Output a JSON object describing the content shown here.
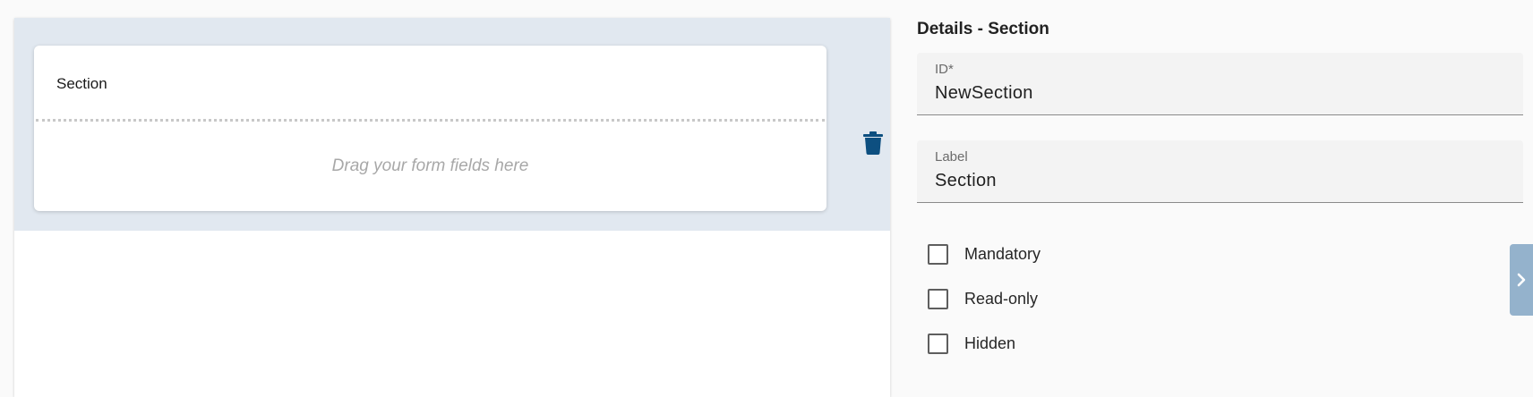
{
  "canvas": {
    "section_title": "Section",
    "drop_hint": "Drag your form fields here"
  },
  "details": {
    "title": "Details - Section",
    "id_field": {
      "caption": "ID*",
      "value": "NewSection"
    },
    "label_field": {
      "caption": "Label",
      "value": "Section"
    },
    "checkboxes": [
      {
        "label": "Mandatory",
        "checked": false
      },
      {
        "label": "Read-only",
        "checked": false
      },
      {
        "label": "Hidden",
        "checked": false
      }
    ]
  },
  "icons": {
    "delete": "trash-icon",
    "expand": "chevron-right-icon"
  },
  "colors": {
    "accent": "#0d4f80",
    "section_zone_bg": "#e1e8f0",
    "expand_tab_bg": "#94b2cc"
  }
}
